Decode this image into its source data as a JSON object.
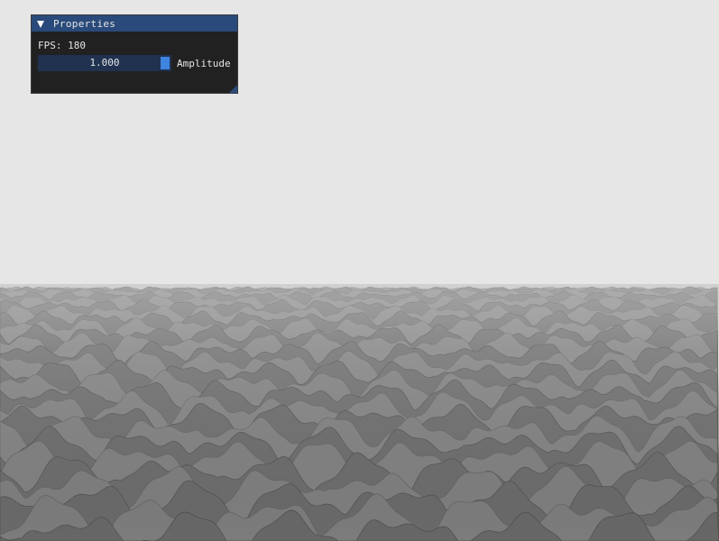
{
  "window": {
    "title": "Properties",
    "collapse_icon": "triangle-down-icon",
    "fps_text": "FPS: 180",
    "fps": 180
  },
  "amplitude": {
    "value_text": "1.000",
    "value": 1.0,
    "label": "Amplitude",
    "grab_fraction": 1.0
  },
  "colors": {
    "sky": "#e6e6e6",
    "terrain_base": "#8a8a8a",
    "title_bar": "#294a7a",
    "slider_frame": "#203250",
    "slider_grab": "#3d85e0"
  }
}
